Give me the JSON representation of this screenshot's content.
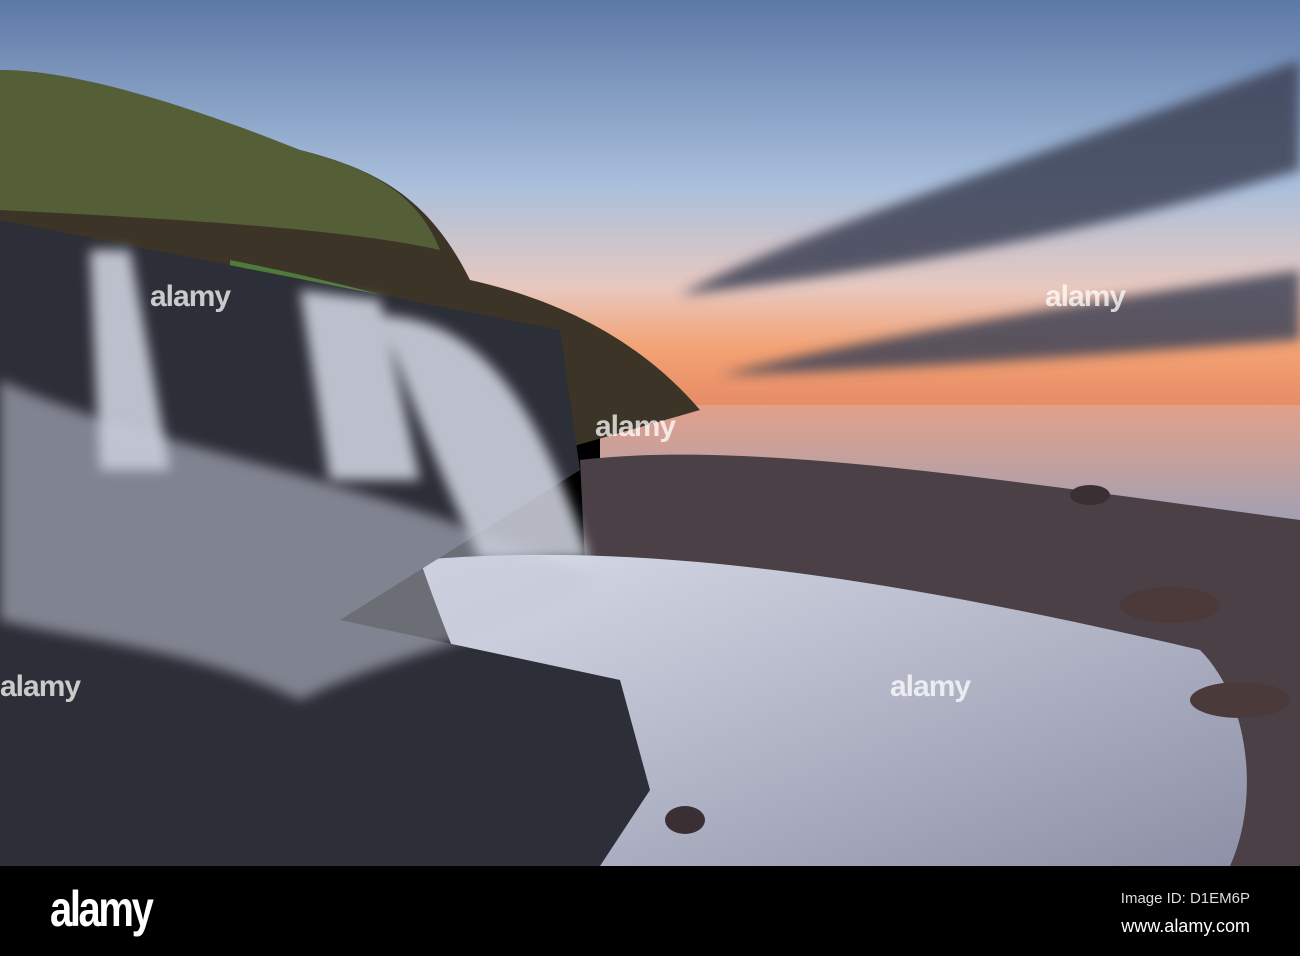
{
  "footer": {
    "logo": "alamy",
    "image_id": "Image ID: D1EM6P",
    "website": "www.alamy.com"
  },
  "watermark": "alamy",
  "colors": {
    "sky_top": "#5f7aa8",
    "horizon": "#f29a6a",
    "sea": "#d99a8a",
    "rock": "#2d2f38",
    "water": "#c9cbd8"
  }
}
